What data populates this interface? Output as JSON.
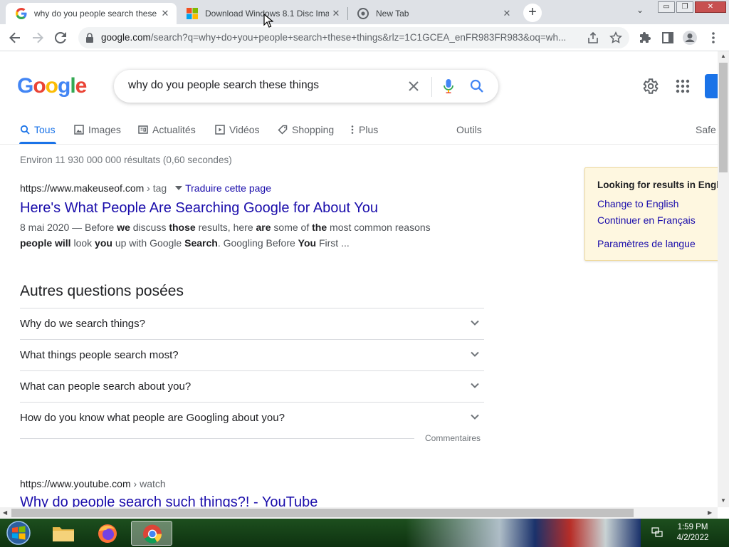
{
  "browser": {
    "tabs": [
      {
        "title": "why do you people search these t",
        "active": true
      },
      {
        "title": "Download Windows 8.1 Disc Ima",
        "active": false
      },
      {
        "title": "New Tab",
        "active": false
      }
    ],
    "tab_close": "✕",
    "new_tab": "+",
    "tab_search": "⌄",
    "win_min": "▭",
    "win_restore": "❐",
    "win_close": "✕",
    "url_host": "google.com",
    "url_rest": "/search?q=why+do+you+people+search+these+things&rlz=1C1GCEA_enFR983FR983&oq=wh...",
    "icons": [
      "back-icon",
      "forward-icon",
      "reload-icon",
      "lock-icon",
      "share-icon",
      "star-icon",
      "extensions-icon",
      "sidebar-icon",
      "profile-icon",
      "menu-icon"
    ]
  },
  "google": {
    "logo_letters": [
      "G",
      "o",
      "o",
      "g",
      "l",
      "e"
    ],
    "logo_colors": [
      "#4285f4",
      "#ea4335",
      "#fbbc05",
      "#4285f4",
      "#34a853",
      "#ea4335"
    ],
    "query": "why do you people search these things",
    "tabs": [
      "Tous",
      "Images",
      "Actualités",
      "Vidéos",
      "Shopping",
      "Plus",
      "Outils",
      "Safe"
    ],
    "stats": "Environ 11 930 000 000 résultats (0,60 secondes)",
    "results": [
      {
        "site": "https://www.makeuseof.com",
        "path": " › tag",
        "translate": "Traduire cette page",
        "title": "Here's What People Are Searching Google for About You",
        "snippet_line1": [
          {
            "t": "8 mai 2020 — Before ",
            "b": false
          },
          {
            "t": "we",
            "b": true
          },
          {
            "t": " discuss ",
            "b": false
          },
          {
            "t": "those",
            "b": true
          },
          {
            "t": " results, here ",
            "b": false
          },
          {
            "t": "are",
            "b": true
          },
          {
            "t": " some of ",
            "b": false
          },
          {
            "t": "the",
            "b": true
          },
          {
            "t": " most common reasons",
            "b": false
          }
        ],
        "snippet_line2": [
          {
            "t": "people will",
            "b": true
          },
          {
            "t": " look ",
            "b": false
          },
          {
            "t": "you",
            "b": true
          },
          {
            "t": " up with Google ",
            "b": false
          },
          {
            "t": "Search",
            "b": true
          },
          {
            "t": ". Googling Before ",
            "b": false
          },
          {
            "t": "You",
            "b": true
          },
          {
            "t": " First ...",
            "b": false
          }
        ]
      },
      {
        "site": "https://www.youtube.com",
        "path": " › watch",
        "title": "Why do people search such things?! - YouTube"
      }
    ],
    "paa_title": "Autres questions posées",
    "paa": [
      "Why do we search things?",
      "What things people search most?",
      "What can people search about you?",
      "How do you know what people are Googling about you?"
    ],
    "feedback": "Commentaires",
    "language_box": {
      "heading": "Looking for results in English?",
      "change": "Change to English",
      "continue": "Continuer en Français",
      "settings": "Paramètres de langue"
    }
  },
  "taskbar": {
    "apps": [
      "windows-explorer-icon",
      "firefox-icon",
      "chrome-icon"
    ],
    "time": "1:59 PM",
    "date": "4/2/2022"
  },
  "colors": {
    "link": "#1a0dab",
    "accent": "#1a73e8",
    "language_box_bg": "#fef7e0",
    "taskbar": "#1d4f1e"
  }
}
